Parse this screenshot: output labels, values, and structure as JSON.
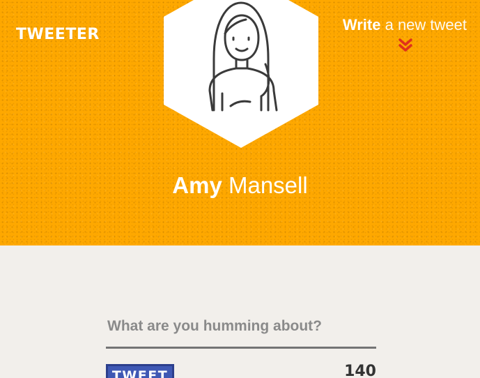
{
  "header": {
    "logo": "TWEETER",
    "write_link": {
      "strong": "Write",
      "light": "a new tweet"
    },
    "profile": {
      "first_name": "Amy",
      "last_name": "Mansell"
    }
  },
  "compose": {
    "placeholder": "What are you humming about?",
    "value": "",
    "tweet_button": "TWEET",
    "char_count": "140"
  },
  "colors": {
    "header_bg": "#fea800",
    "page_bg": "#f2efeb",
    "button_bg": "#3f58b4",
    "accent_chevron": "#e0311b"
  },
  "icons": {
    "avatar": "woman-avatar-icon",
    "chevron": "double-chevron-down-icon"
  }
}
